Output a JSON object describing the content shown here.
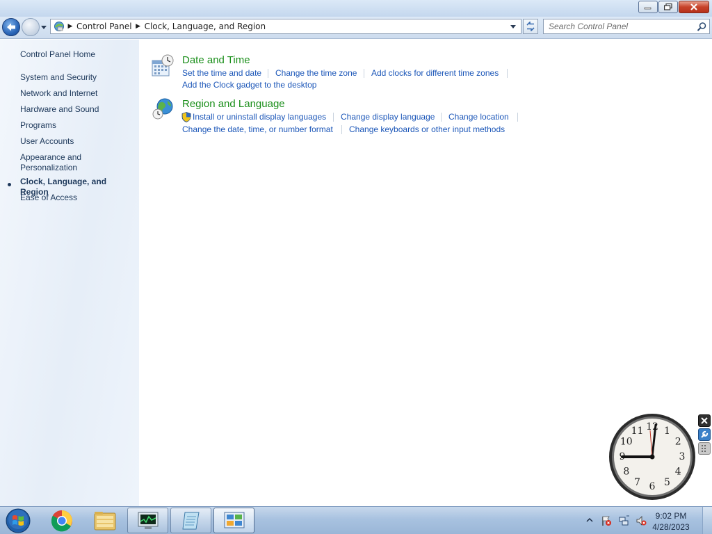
{
  "window": {
    "minimize_icon": "minimize-icon",
    "maximize_icon": "restore-icon",
    "close_icon": "close-icon"
  },
  "nav": {
    "breadcrumbs": [
      "Control Panel",
      "Clock, Language, and Region"
    ],
    "search_placeholder": "Search Control Panel"
  },
  "sidebar": {
    "items": [
      {
        "label": "Control Panel Home"
      },
      {
        "label": "System and Security"
      },
      {
        "label": "Network and Internet"
      },
      {
        "label": "Hardware and Sound"
      },
      {
        "label": "Programs"
      },
      {
        "label": "User Accounts"
      },
      {
        "label": "Appearance and Personalization"
      },
      {
        "label": "Clock, Language, and Region",
        "active": true
      },
      {
        "label": "Ease of Access"
      }
    ]
  },
  "categories": [
    {
      "title": "Date and Time",
      "icon": "date-time-icon",
      "links": [
        "Set the time and date",
        "Change the time zone",
        "Add clocks for different time zones",
        "Add the Clock gadget to the desktop"
      ]
    },
    {
      "title": "Region and Language",
      "icon": "globe-icon",
      "links": [
        "Install or uninstall display languages",
        "Change display language",
        "Change location",
        "Change the date, time, or number format",
        "Change keyboards or other input methods"
      ]
    }
  ],
  "clock_gadget": {
    "numerals": [
      "12",
      "1",
      "2",
      "3",
      "4",
      "5",
      "6",
      "7",
      "8",
      "9",
      "10",
      "11"
    ]
  },
  "taskbar": {
    "apps": [
      "windows-start-icon",
      "chrome-icon",
      "file-explorer-icon",
      "task-manager-icon",
      "notepad-icon",
      "control-panel-icon"
    ],
    "time": "9:02 PM",
    "date": "4/28/2023"
  },
  "colors": {
    "link": "#1b56b8",
    "category_title": "#1b8f1b",
    "sidebar_text": "#1e395b"
  }
}
